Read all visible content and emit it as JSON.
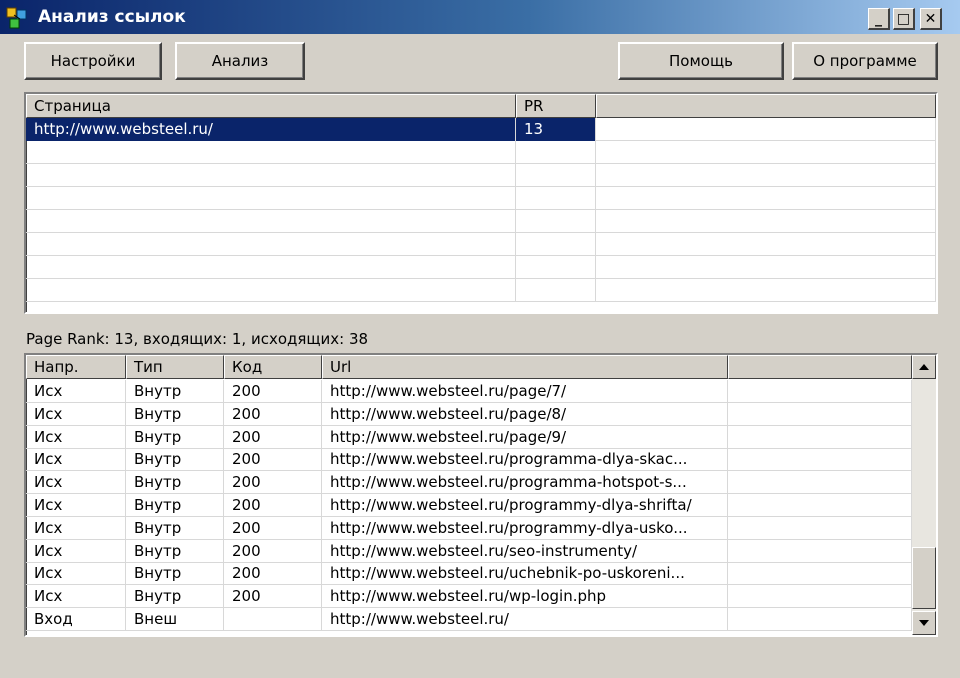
{
  "window": {
    "title": "Анализ ссылок",
    "minimize_glyph": "_",
    "maximize_glyph": "□",
    "close_glyph": "✕"
  },
  "toolbar": {
    "settings_label": "Настройки",
    "analysis_label": "Анализ",
    "help_label": "Помощь",
    "about_label": "О программе"
  },
  "pages_table": {
    "columns": [
      "Страница",
      "PR",
      ""
    ],
    "rows": [
      {
        "page": "http://www.websteel.ru/",
        "pr": "13",
        "selected": true
      }
    ],
    "empty_rows": 7
  },
  "status": {
    "text": "Page Rank: 13, входящих: 1, исходящих: 38"
  },
  "links_table": {
    "columns": [
      "Напр.",
      "Тип",
      "Код",
      "Url",
      ""
    ],
    "rows": [
      {
        "dir": "Исх",
        "type": "Внутр",
        "code": "200",
        "url": "http://www.websteel.ru/page/7/"
      },
      {
        "dir": "Исх",
        "type": "Внутр",
        "code": "200",
        "url": "http://www.websteel.ru/page/8/"
      },
      {
        "dir": "Исх",
        "type": "Внутр",
        "code": "200",
        "url": "http://www.websteel.ru/page/9/"
      },
      {
        "dir": "Исх",
        "type": "Внутр",
        "code": "200",
        "url": "http://www.websteel.ru/programma-dlya-skac..."
      },
      {
        "dir": "Исх",
        "type": "Внутр",
        "code": "200",
        "url": "http://www.websteel.ru/programma-hotspot-s..."
      },
      {
        "dir": "Исх",
        "type": "Внутр",
        "code": "200",
        "url": "http://www.websteel.ru/programmy-dlya-shrifta/"
      },
      {
        "dir": "Исх",
        "type": "Внутр",
        "code": "200",
        "url": "http://www.websteel.ru/programmy-dlya-usko..."
      },
      {
        "dir": "Исх",
        "type": "Внутр",
        "code": "200",
        "url": "http://www.websteel.ru/seo-instrumenty/"
      },
      {
        "dir": "Исх",
        "type": "Внутр",
        "code": "200",
        "url": "http://www.websteel.ru/uchebnik-po-uskoreni..."
      },
      {
        "dir": "Исх",
        "type": "Внутр",
        "code": "200",
        "url": "http://www.websteel.ru/wp-login.php"
      },
      {
        "dir": "Вход",
        "type": "Внеш",
        "code": "",
        "url": "http://www.websteel.ru/"
      }
    ]
  },
  "colors": {
    "titlebar_start": "#0a246a",
    "titlebar_end": "#a6caf0",
    "selection": "#0a246a",
    "face": "#d4d0c8"
  },
  "icons": {
    "app": "app-icon",
    "scroll_up": "scroll-up-arrow-icon",
    "scroll_down": "scroll-down-arrow-icon"
  }
}
